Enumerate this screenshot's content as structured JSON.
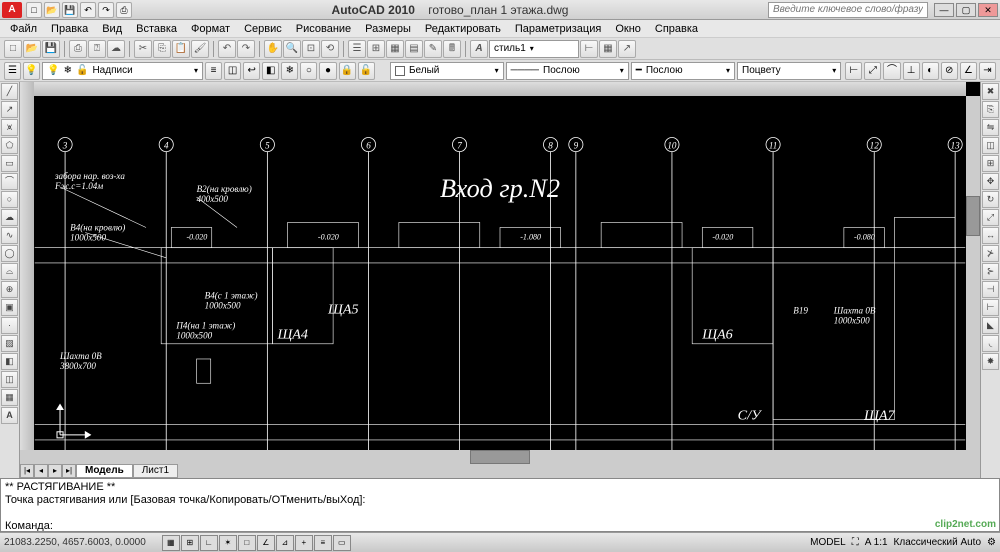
{
  "title": {
    "app": "AutoCAD 2010",
    "file": "готово_план 1 этажа.dwg"
  },
  "search_placeholder": "Введите ключевое слово/фразу",
  "menu": [
    "Файл",
    "Правка",
    "Вид",
    "Вставка",
    "Формат",
    "Сервис",
    "Рисование",
    "Размеры",
    "Редактировать",
    "Параметризация",
    "Окно",
    "Справка"
  ],
  "style_dropdown": "стиль1",
  "layer_dropdown": "Надписи",
  "color_dropdown": "Белый",
  "ltype_dropdown": "Послою",
  "lweight_dropdown": "Послою",
  "plotstyle_dropdown": "Поцвету",
  "drawing": {
    "big_label": "Вход гр.N2",
    "bubbles": [
      "3",
      "4",
      "5",
      "6",
      "7",
      "8",
      "9",
      "10",
      "11",
      "12",
      "13"
    ],
    "labels": {
      "zabor": "забора нар. воз-ха",
      "fzhs": "Fж.с=1.04м",
      "b2": "В2(на кровлю)",
      "b2dim": "400х500",
      "b4": "В4(на кровлю)",
      "b4dim": "1000х500",
      "b4e": "В4(с 1 этаж)",
      "b4edim": "1000х500",
      "p4": "П4(на 1 этаж)",
      "p4dim": "1000х500",
      "shahta_ov": "Шахта 0В",
      "shahta_dim": "3800х700",
      "shcha4": "ЩА4",
      "shcha5": "ЩА5",
      "shcha6": "ЩА6",
      "shcha7": "ЩА7",
      "b19": "В19",
      "shahta2": "Шахта 0В",
      "shahta2dim": "1000х500",
      "su": "С/У",
      "lev020a": "-0.020",
      "lev020b": "-0.020",
      "lev1080": "-1.080",
      "lev020c": "-0.020",
      "lev080": "-0.080"
    }
  },
  "sheets": {
    "model": "Модель",
    "sheet1": "Лист1"
  },
  "cmd": {
    "l1": "** РАСТЯГИВАНИЕ **",
    "l2": "Точка растягивания или [Базовая точка/Копировать/ОТменить/выХод]:",
    "l3": "Команда:"
  },
  "status": {
    "coords": "21083.2250, 4657.6003, 0.0000",
    "snap": "ШАГ",
    "grid": "СЕТКА",
    "scale": "A 1:1",
    "workspace": "Классический Auto"
  },
  "watermark": "clip2net.com"
}
